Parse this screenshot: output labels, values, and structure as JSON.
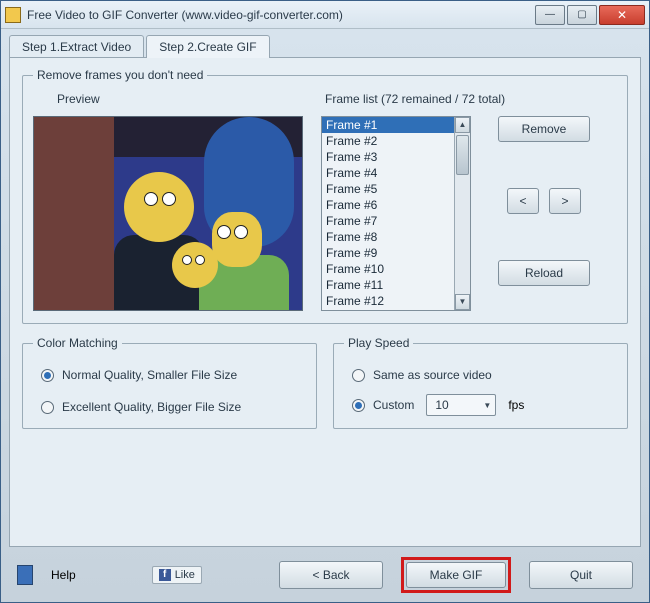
{
  "window": {
    "title": "Free Video to GIF Converter (www.video-gif-converter.com)"
  },
  "tabs": {
    "step1": "Step 1.Extract Video",
    "step2": "Step 2.Create GIF"
  },
  "frames_group": {
    "legend": "Remove frames you don't need",
    "preview_label": "Preview",
    "frame_list_label": "Frame list (72 remained / 72 total)",
    "items": [
      "Frame #1",
      "Frame #2",
      "Frame #3",
      "Frame #4",
      "Frame #5",
      "Frame #6",
      "Frame #7",
      "Frame #8",
      "Frame #9",
      "Frame #10",
      "Frame #11",
      "Frame #12"
    ],
    "selected_index": 0,
    "remove_label": "Remove",
    "prev_label": "<",
    "next_label": ">",
    "reload_label": "Reload"
  },
  "color_matching": {
    "legend": "Color Matching",
    "opt_normal": "Normal Quality, Smaller File Size",
    "opt_excellent": "Excellent Quality, Bigger File Size",
    "selected": "normal"
  },
  "play_speed": {
    "legend": "Play Speed",
    "opt_same": "Same as source video",
    "opt_custom": "Custom",
    "selected": "custom",
    "value": "10",
    "unit": "fps"
  },
  "bottom": {
    "help": "Help",
    "like": "Like",
    "back": "< Back",
    "make": "Make GIF",
    "quit": "Quit"
  }
}
